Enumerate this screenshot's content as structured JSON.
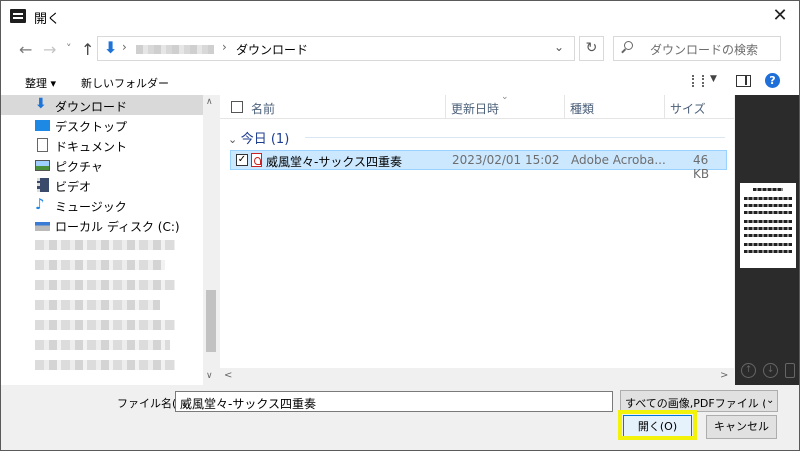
{
  "window": {
    "title": "開く"
  },
  "nav": {
    "back_icon": "←",
    "forward_icon": "→",
    "recent_icon": "˅",
    "up_icon": "↑",
    "address_current": "ダウンロード",
    "search_placeholder": "ダウンロードの検索"
  },
  "toolbar": {
    "organize": "整理 ▾",
    "new_folder": "新しいフォルダー"
  },
  "sidebar": {
    "items": [
      {
        "label": "ダウンロード",
        "icon": "download-icon"
      },
      {
        "label": "デスクトップ",
        "icon": "desktop-icon"
      },
      {
        "label": "ドキュメント",
        "icon": "document-icon"
      },
      {
        "label": "ピクチャ",
        "icon": "picture-icon"
      },
      {
        "label": "ビデオ",
        "icon": "video-icon"
      },
      {
        "label": "ミュージック",
        "icon": "music-icon"
      },
      {
        "label": "ローカル ディスク (C:)",
        "icon": "disk-icon"
      }
    ]
  },
  "filelist": {
    "columns": [
      "名前",
      "更新日時",
      "種類",
      "サイズ"
    ],
    "group": "今日 (1)",
    "rows": [
      {
        "name": "威風堂々-サックス四重奏",
        "modified": "2023/02/01 15:02",
        "type": "Adobe Acroba...",
        "size": "46 KB"
      }
    ]
  },
  "bottom": {
    "filename_label": "ファイル名(N):",
    "filename_value": "威風堂々-サックス四重奏",
    "filter_value": "すべての画像,PDFファイル (*.bmp;",
    "open_button": "開く(O)",
    "cancel_button": "キャンセル"
  },
  "colors": {
    "accent": "#0078d7",
    "highlight": "#f2f20a",
    "selection": "#cce8ff"
  }
}
